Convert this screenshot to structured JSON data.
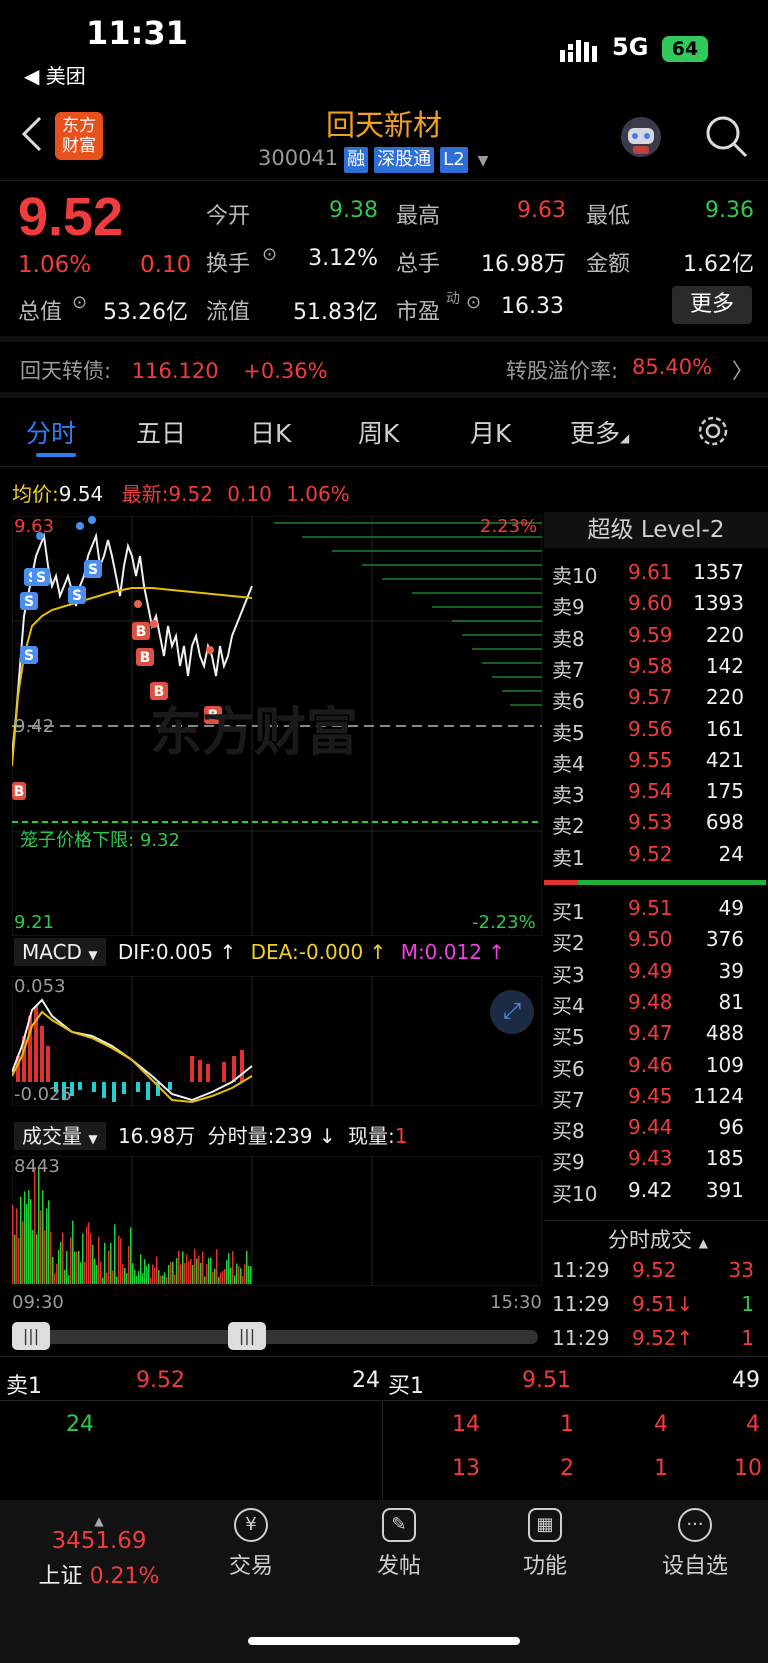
{
  "status_bar": {
    "time": "11:31",
    "back_app": "◀ 美团",
    "network": "5G",
    "battery": "64"
  },
  "header": {
    "title": "回天新材",
    "code": "300041",
    "tags": [
      "融",
      "深股通",
      "L2"
    ],
    "logo_text": "东方财富"
  },
  "quote": {
    "price": "9.52",
    "change_pct": "1.06%",
    "change": "0.10",
    "open_label": "今开",
    "open": "9.38",
    "high_label": "最高",
    "high": "9.63",
    "low_label": "最低",
    "low": "9.36",
    "turnover_label": "换手",
    "turnover": "3.12%",
    "volume_label": "总手",
    "volume": "16.98万",
    "amount_label": "金额",
    "amount": "1.62亿",
    "mktcap_label": "总值",
    "mktcap": "53.26亿",
    "float_label": "流值",
    "float_cap": "51.83亿",
    "pe_label": "市盈",
    "pe_sup": "动",
    "pe": "16.33",
    "more": "更多"
  },
  "bond": {
    "name": "回天转债:",
    "price": "116.120",
    "change": "+0.36%",
    "premium_label": "转股溢价率:",
    "premium": "85.40%"
  },
  "tabs": [
    "分时",
    "五日",
    "日K",
    "周K",
    "月K",
    "更多"
  ],
  "intraday": {
    "avg_label": "均价:",
    "avg": "9.54",
    "latest_label": "最新:",
    "latest": "9.52",
    "chg": "0.10",
    "chg_pct": "1.06%",
    "y_top": "9.63",
    "y_mid": "9.42",
    "y_bottom": "9.21",
    "pct_top": "2.23%",
    "pct_bottom": "-2.23%",
    "cage_label": "笼子价格下限:",
    "cage_value": "9.32",
    "watermark": "东方财富",
    "time_start": "09:30",
    "time_end": "15:30"
  },
  "macd": {
    "title": "MACD",
    "dif": "DIF:0.005 ↑",
    "dea": "DEA:-0.000 ↑",
    "m": "M:0.012 ↑",
    "top": "0.053",
    "bottom": "-0.025"
  },
  "volume": {
    "title": "成交量",
    "total": "16.98万",
    "tick_label": "分时量:",
    "tick": "239 ↓",
    "now_label": "现量:",
    "now": "1",
    "max": "8443"
  },
  "level2": {
    "title": "超级 Level-2"
  },
  "asks": [
    {
      "label": "卖10",
      "price": "9.61",
      "vol": "1357"
    },
    {
      "label": "卖9",
      "price": "9.60",
      "vol": "1393"
    },
    {
      "label": "卖8",
      "price": "9.59",
      "vol": "220"
    },
    {
      "label": "卖7",
      "price": "9.58",
      "vol": "142"
    },
    {
      "label": "卖6",
      "price": "9.57",
      "vol": "220"
    },
    {
      "label": "卖5",
      "price": "9.56",
      "vol": "161"
    },
    {
      "label": "卖4",
      "price": "9.55",
      "vol": "421"
    },
    {
      "label": "卖3",
      "price": "9.54",
      "vol": "175"
    },
    {
      "label": "卖2",
      "price": "9.53",
      "vol": "698"
    },
    {
      "label": "卖1",
      "price": "9.52",
      "vol": "24"
    }
  ],
  "bids": [
    {
      "label": "买1",
      "price": "9.51",
      "vol": "49"
    },
    {
      "label": "买2",
      "price": "9.50",
      "vol": "376"
    },
    {
      "label": "买3",
      "price": "9.49",
      "vol": "39"
    },
    {
      "label": "买4",
      "price": "9.48",
      "vol": "81"
    },
    {
      "label": "买5",
      "price": "9.47",
      "vol": "488"
    },
    {
      "label": "买6",
      "price": "9.46",
      "vol": "109"
    },
    {
      "label": "买7",
      "price": "9.45",
      "vol": "1124"
    },
    {
      "label": "买8",
      "price": "9.44",
      "vol": "96"
    },
    {
      "label": "买9",
      "price": "9.43",
      "vol": "185"
    },
    {
      "label": "买10",
      "price": "9.42",
      "vol": "391"
    }
  ],
  "ticks": {
    "title": "分时成交",
    "rows": [
      {
        "time": "11:29",
        "price": "9.52",
        "vol": "33"
      },
      {
        "time": "11:29",
        "price": "9.51↓",
        "vol": "1"
      },
      {
        "time": "11:29",
        "price": "9.52↑",
        "vol": "1"
      }
    ]
  },
  "queue": {
    "sell_label": "卖1",
    "sell_price": "9.52",
    "sell_total": "24",
    "buy_label": "买1",
    "buy_price": "9.51",
    "buy_total": "49",
    "sell_orders": [
      "24"
    ],
    "buy_orders": [
      "14",
      "1",
      "4",
      "4",
      "13",
      "2",
      "1",
      "10"
    ]
  },
  "bottom_nav": {
    "index_value": "3451.69",
    "index_name": "上证",
    "index_pct": "0.21%",
    "items": [
      "交易",
      "发帖",
      "功能",
      "设自选"
    ]
  }
}
